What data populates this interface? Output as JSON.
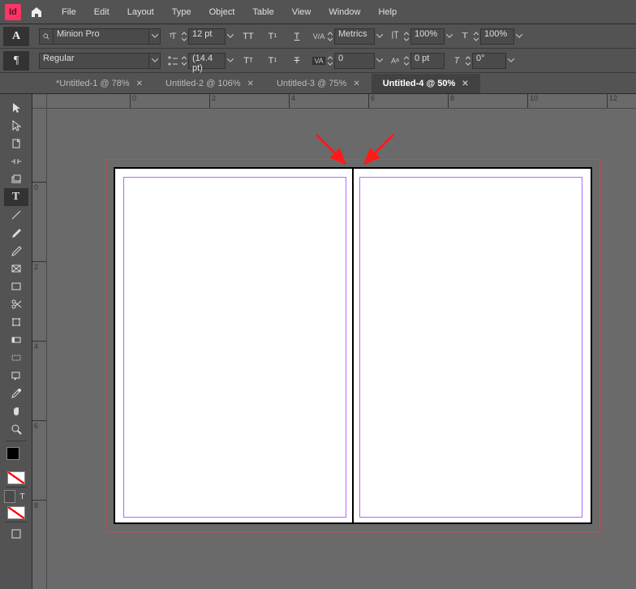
{
  "app_logo_letters": "Id",
  "menu": {
    "items": [
      "File",
      "Edit",
      "Layout",
      "Type",
      "Object",
      "Table",
      "View",
      "Window",
      "Help"
    ]
  },
  "char_panel": {
    "font_family": "Minion Pro",
    "font_style": "Regular",
    "font_size": "12 pt",
    "leading": "(14.4 pt)",
    "kerning_method": "Metrics",
    "tracking": "0",
    "scale_horizontal": "100%",
    "scale_vertical": "100%",
    "baseline_shift": "0 pt",
    "skew": "0°"
  },
  "tabs": [
    {
      "label": "*Untitled-1 @ 78%",
      "active": false
    },
    {
      "label": "Untitled-2 @ 106%",
      "active": false
    },
    {
      "label": "Untitled-3 @ 75%",
      "active": false
    },
    {
      "label": "Untitled-4 @ 50%",
      "active": true
    }
  ],
  "ruler": {
    "marks": [
      "0",
      "2",
      "4",
      "6",
      "8",
      "10",
      "12"
    ],
    "v_marks": [
      "0",
      "2",
      "4",
      "6",
      "8"
    ]
  }
}
